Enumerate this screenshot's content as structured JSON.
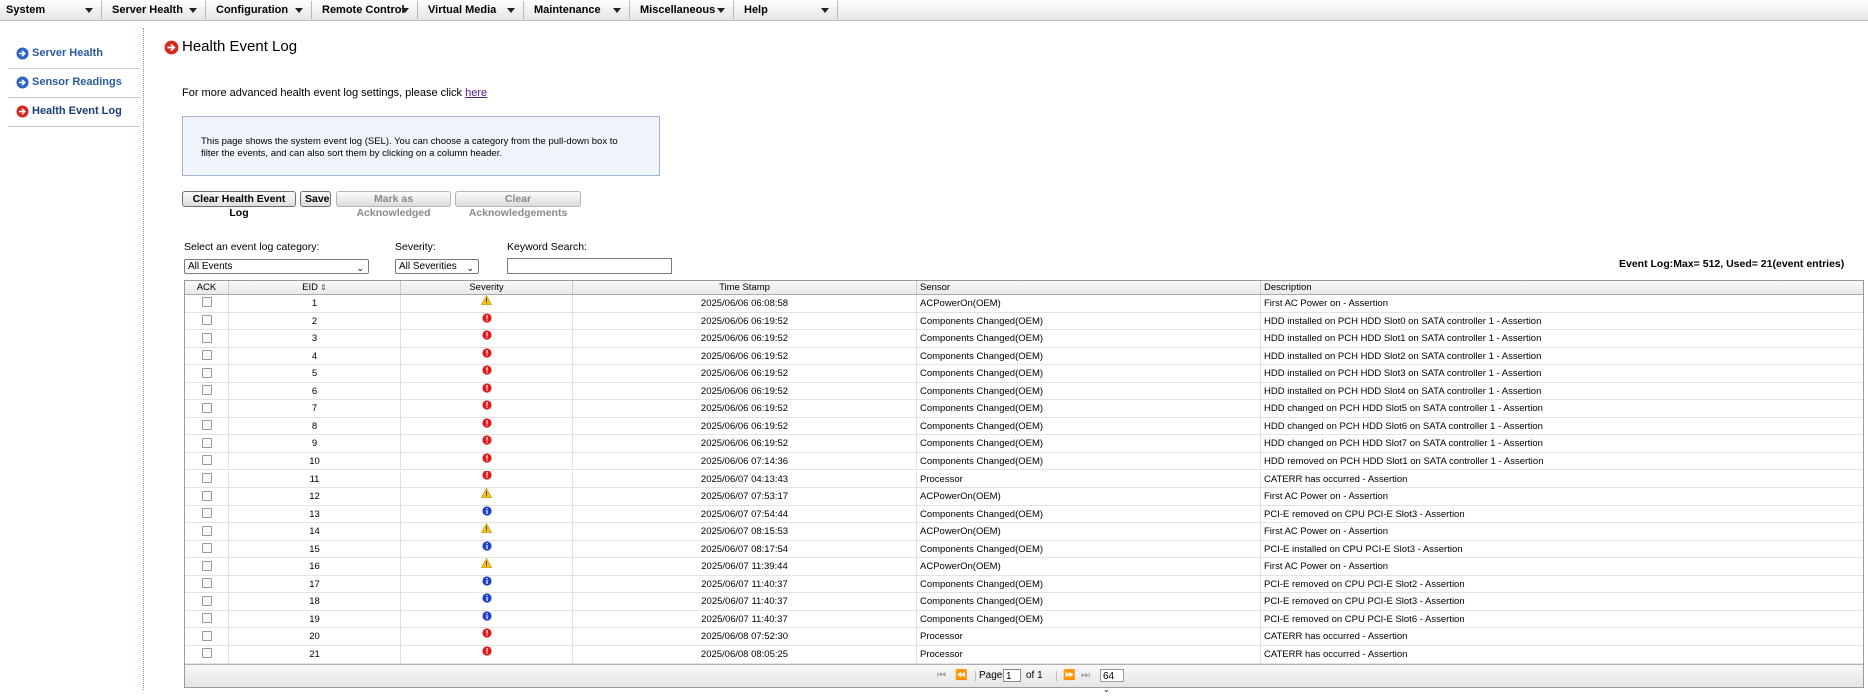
{
  "menu": [
    {
      "label": "System"
    },
    {
      "label": "Server Health"
    },
    {
      "label": "Configuration"
    },
    {
      "label": "Remote Control"
    },
    {
      "label": "Virtual Media"
    },
    {
      "label": "Maintenance"
    },
    {
      "label": "Miscellaneous"
    },
    {
      "label": "Help"
    }
  ],
  "sidebar": {
    "items": [
      {
        "label": "Server Health",
        "icon": "blue-arrow-icon"
      },
      {
        "label": "Sensor Readings",
        "icon": "blue-arrow-icon"
      },
      {
        "label": "Health Event Log",
        "icon": "red-arrow-icon",
        "active": true
      }
    ]
  },
  "page": {
    "title": "Health Event Log",
    "advanced_text": "For more advanced health event log settings, please click ",
    "advanced_link": "here",
    "info": "This page shows the system event log (SEL). You can choose a category from the pull-down box to filter the events, and can also sort them by clicking on a column header."
  },
  "buttons": {
    "clear_log": "Clear Health Event Log",
    "save": "Save",
    "mark_ack": "Mark as Acknowledged",
    "clear_ack": "Clear Acknowledgements"
  },
  "filters": {
    "category_label": "Select an event log category:",
    "category_value": "All Events",
    "severity_label": "Severity:",
    "severity_value": "All Severities",
    "keyword_label": "Keyword Search:",
    "keyword_value": ""
  },
  "log_usage": "Event Log:Max= 512, Used= 21(event entries)",
  "columns": {
    "ack": "ACK",
    "eid": "EID",
    "severity": "Severity",
    "timestamp": "Time Stamp",
    "sensor": "Sensor",
    "description": "Description"
  },
  "colors": {
    "warning": "#f5c518",
    "critical": "#e01b1b",
    "info": "#1f3fd1",
    "link_blue": "#2b5c9c"
  },
  "rows": [
    {
      "eid": "1",
      "severity": "warning",
      "timestamp": "2025/06/06 06:08:58",
      "sensor": "ACPowerOn(OEM)",
      "description": "First AC Power on - Assertion"
    },
    {
      "eid": "2",
      "severity": "critical",
      "timestamp": "2025/06/06 06:19:52",
      "sensor": "Components Changed(OEM)",
      "description": "HDD installed on PCH HDD Slot0 on SATA controller 1 - Assertion"
    },
    {
      "eid": "3",
      "severity": "critical",
      "timestamp": "2025/06/06 06:19:52",
      "sensor": "Components Changed(OEM)",
      "description": "HDD installed on PCH HDD Slot1 on SATA controller 1 - Assertion"
    },
    {
      "eid": "4",
      "severity": "critical",
      "timestamp": "2025/06/06 06:19:52",
      "sensor": "Components Changed(OEM)",
      "description": "HDD installed on PCH HDD Slot2 on SATA controller 1 - Assertion"
    },
    {
      "eid": "5",
      "severity": "critical",
      "timestamp": "2025/06/06 06:19:52",
      "sensor": "Components Changed(OEM)",
      "description": "HDD installed on PCH HDD Slot3 on SATA controller 1 - Assertion"
    },
    {
      "eid": "6",
      "severity": "critical",
      "timestamp": "2025/06/06 06:19:52",
      "sensor": "Components Changed(OEM)",
      "description": "HDD installed on PCH HDD Slot4 on SATA controller 1 - Assertion"
    },
    {
      "eid": "7",
      "severity": "critical",
      "timestamp": "2025/06/06 06:19:52",
      "sensor": "Components Changed(OEM)",
      "description": "HDD changed on PCH HDD Slot5 on SATA controller 1 - Assertion"
    },
    {
      "eid": "8",
      "severity": "critical",
      "timestamp": "2025/06/06 06:19:52",
      "sensor": "Components Changed(OEM)",
      "description": "HDD changed on PCH HDD Slot6 on SATA controller 1 - Assertion"
    },
    {
      "eid": "9",
      "severity": "critical",
      "timestamp": "2025/06/06 06:19:52",
      "sensor": "Components Changed(OEM)",
      "description": "HDD changed on PCH HDD Slot7 on SATA controller 1 - Assertion"
    },
    {
      "eid": "10",
      "severity": "critical",
      "timestamp": "2025/06/06 07:14:36",
      "sensor": "Components Changed(OEM)",
      "description": "HDD removed on PCH HDD Slot1 on SATA controller 1 - Assertion"
    },
    {
      "eid": "11",
      "severity": "critical",
      "timestamp": "2025/06/07 04:13:43",
      "sensor": "Processor",
      "description": "CATERR has occurred - Assertion"
    },
    {
      "eid": "12",
      "severity": "warning",
      "timestamp": "2025/06/07 07:53:17",
      "sensor": "ACPowerOn(OEM)",
      "description": "First AC Power on - Assertion"
    },
    {
      "eid": "13",
      "severity": "info",
      "timestamp": "2025/06/07 07:54:44",
      "sensor": "Components Changed(OEM)",
      "description": "PCI-E removed on CPU PCI-E Slot3 - Assertion"
    },
    {
      "eid": "14",
      "severity": "warning",
      "timestamp": "2025/06/07 08:15:53",
      "sensor": "ACPowerOn(OEM)",
      "description": "First AC Power on - Assertion"
    },
    {
      "eid": "15",
      "severity": "info",
      "timestamp": "2025/06/07 08:17:54",
      "sensor": "Components Changed(OEM)",
      "description": "PCI-E installed on CPU PCI-E Slot3 - Assertion"
    },
    {
      "eid": "16",
      "severity": "warning",
      "timestamp": "2025/06/07 11:39:44",
      "sensor": "ACPowerOn(OEM)",
      "description": "First AC Power on - Assertion"
    },
    {
      "eid": "17",
      "severity": "info",
      "timestamp": "2025/06/07 11:40:37",
      "sensor": "Components Changed(OEM)",
      "description": "PCI-E removed on CPU PCI-E Slot2 - Assertion"
    },
    {
      "eid": "18",
      "severity": "info",
      "timestamp": "2025/06/07 11:40:37",
      "sensor": "Components Changed(OEM)",
      "description": "PCI-E removed on CPU PCI-E Slot3 - Assertion"
    },
    {
      "eid": "19",
      "severity": "info",
      "timestamp": "2025/06/07 11:40:37",
      "sensor": "Components Changed(OEM)",
      "description": "PCI-E removed on CPU PCI-E Slot6 - Assertion"
    },
    {
      "eid": "20",
      "severity": "critical",
      "timestamp": "2025/06/08 07:52:30",
      "sensor": "Processor",
      "description": "CATERR has occurred - Assertion"
    },
    {
      "eid": "21",
      "severity": "critical",
      "timestamp": "2025/06/08 08:05:25",
      "sensor": "Processor",
      "description": "CATERR has occurred - Assertion"
    }
  ],
  "pager": {
    "page_label": "Page",
    "page_value": "1",
    "of_label": "of 1",
    "per_page": "64"
  }
}
